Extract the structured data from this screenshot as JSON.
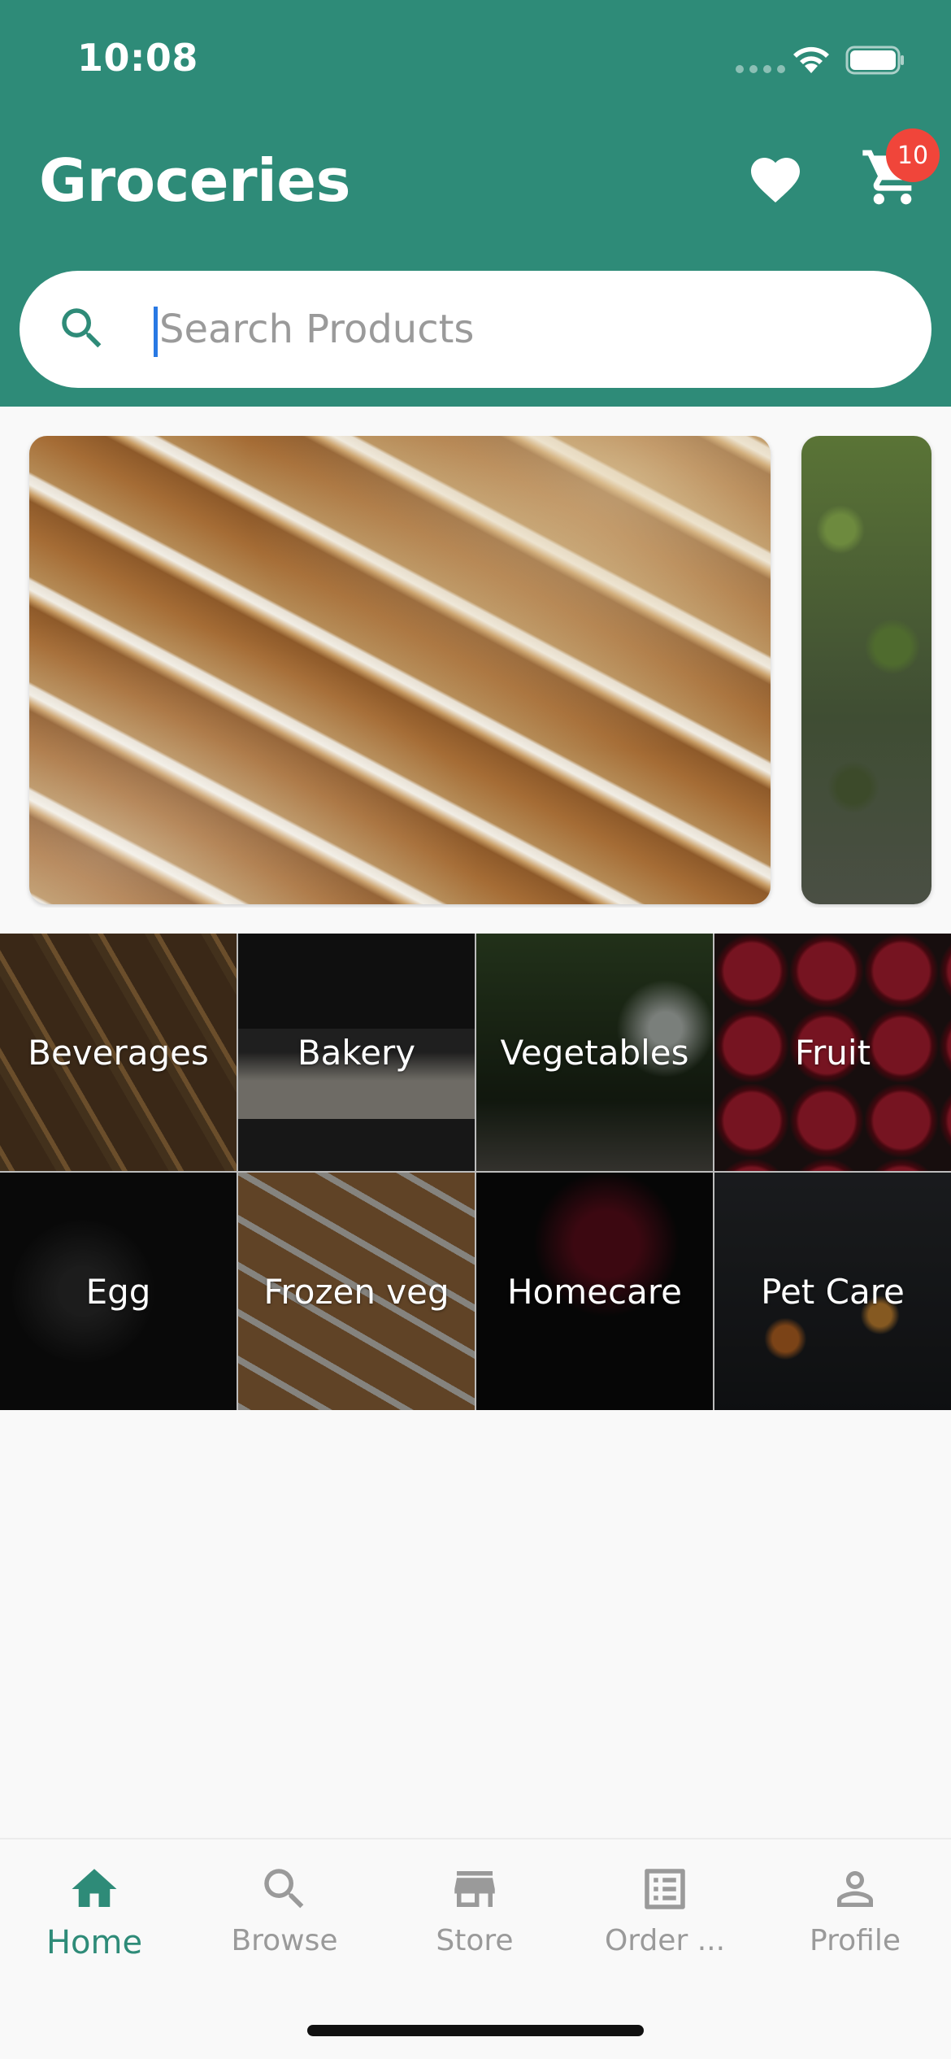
{
  "status_bar": {
    "time": "10:08"
  },
  "header": {
    "title": "Groceries",
    "cart_badge_count": "10",
    "accent_color": "#2e8b78"
  },
  "search": {
    "placeholder": "Search Products",
    "value": ""
  },
  "carousel": {
    "banners": [
      "banner-1",
      "banner-2"
    ]
  },
  "categories": [
    {
      "label": "Beverages"
    },
    {
      "label": "Bakery"
    },
    {
      "label": "Vegetables"
    },
    {
      "label": "Fruit"
    },
    {
      "label": "Egg"
    },
    {
      "label": "Frozen veg"
    },
    {
      "label": "Homecare"
    },
    {
      "label": "Pet Care"
    }
  ],
  "bottom_nav": {
    "items": [
      {
        "label": "Home",
        "icon": "home-icon",
        "active": true
      },
      {
        "label": "Browse",
        "icon": "search-icon",
        "active": false
      },
      {
        "label": "Store",
        "icon": "store-icon",
        "active": false
      },
      {
        "label": "Order ...",
        "icon": "order-list-icon",
        "active": false
      },
      {
        "label": "Profile",
        "icon": "profile-icon",
        "active": false
      }
    ]
  },
  "colors": {
    "badge": "#f0453a",
    "caret": "#2979e4",
    "inactive": "#9a9a9a"
  }
}
